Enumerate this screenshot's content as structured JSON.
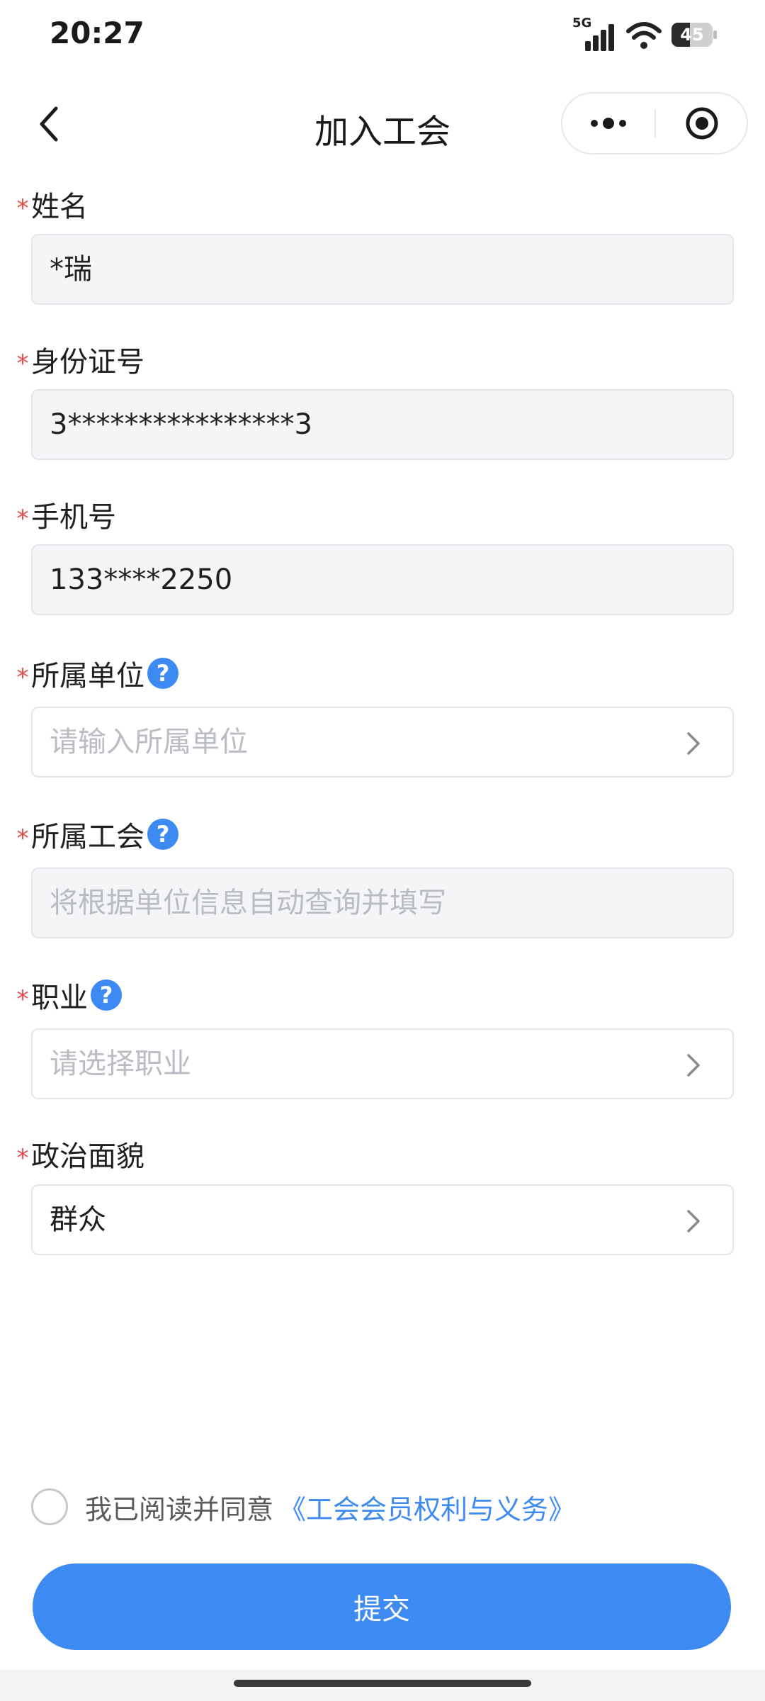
{
  "status_bar": {
    "time": "20:27",
    "network_label": "5G",
    "battery_level": "45",
    "battery_fraction": 0.45
  },
  "nav": {
    "title": "加入工会",
    "back_icon": "chevron-left-icon",
    "more_icon": "more-dots-icon",
    "close_icon": "target-circle-icon"
  },
  "form": {
    "required_mark": "*",
    "help_glyph": "?",
    "name": {
      "label": "姓名",
      "value": "*瑞"
    },
    "id_number": {
      "label": "身份证号",
      "value": "3****************3"
    },
    "phone": {
      "label": "手机号",
      "value": "133****2250"
    },
    "employer": {
      "label": "所属单位",
      "placeholder": "请输入所属单位"
    },
    "union": {
      "label": "所属工会",
      "placeholder": "将根据单位信息自动查询并填写"
    },
    "occupation": {
      "label": "职业",
      "placeholder": "请选择职业"
    },
    "political_status": {
      "label": "政治面貌",
      "value": "群众"
    }
  },
  "agreement": {
    "text": "我已阅读并同意",
    "link": "《工会会员权利与义务》",
    "checked": false
  },
  "submit": {
    "label": "提交"
  },
  "colors": {
    "accent": "#3d8bf2",
    "required": "#e64c4c",
    "placeholder": "#b9bcc3",
    "input_bg_disabled": "#f4f5f7"
  }
}
